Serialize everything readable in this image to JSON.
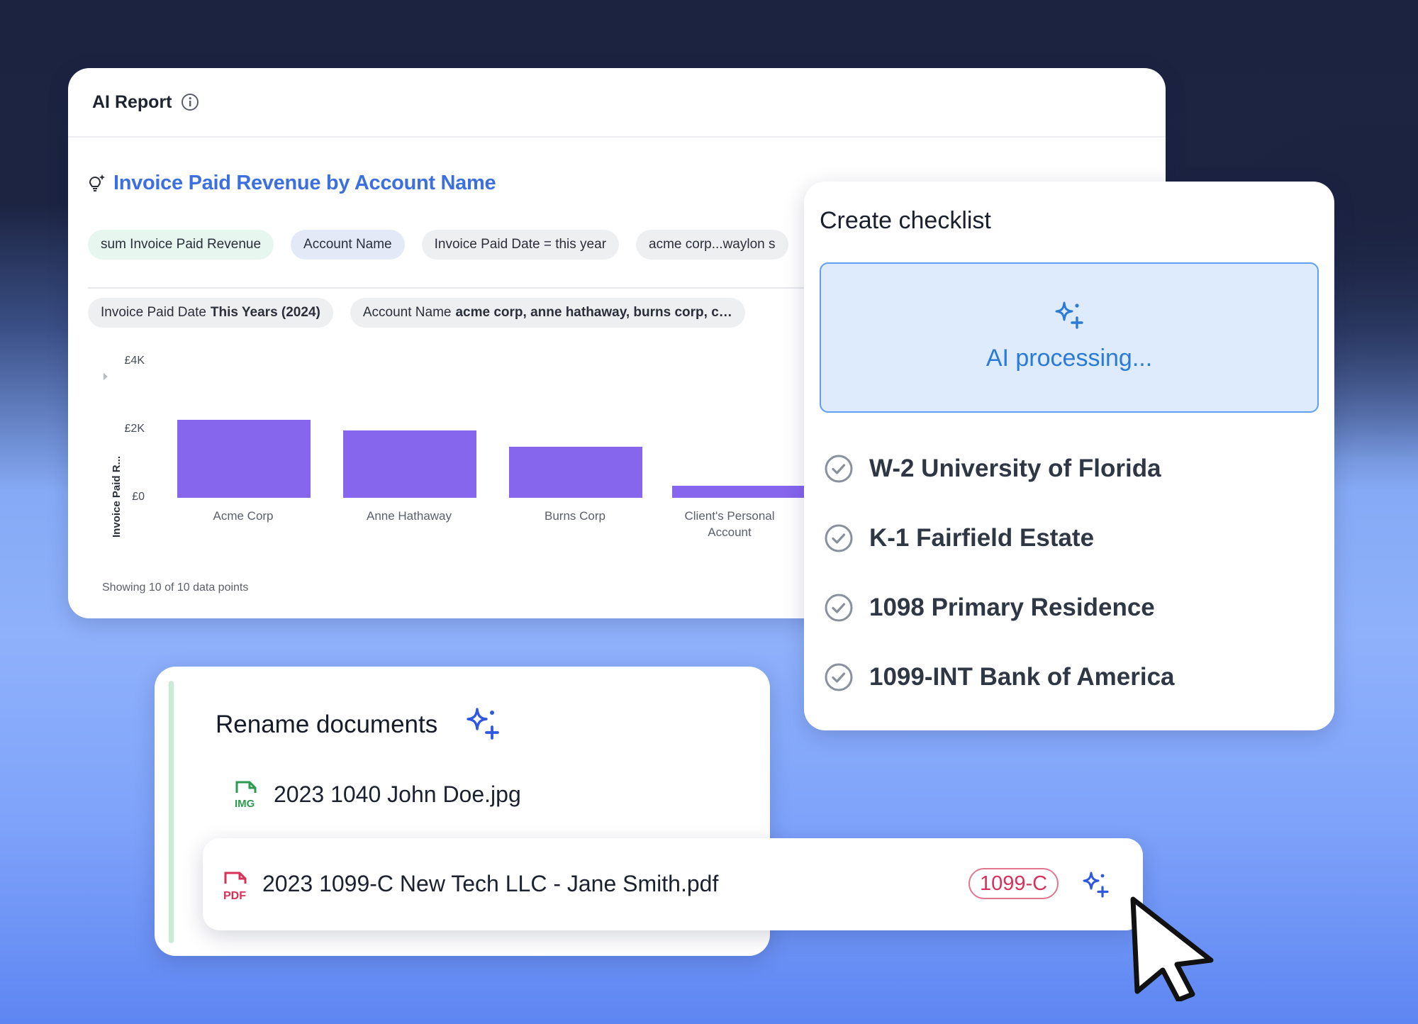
{
  "report": {
    "title": "AI Report",
    "chart_heading": "Invoice Paid Revenue by Account Name",
    "pills_row1": [
      {
        "text": "sum  Invoice Paid Revenue",
        "bg": "#e7f6ef"
      },
      {
        "text": "Account Name",
        "bg": "#e4e9f8"
      },
      {
        "text": "Invoice Paid Date = this year",
        "bg": "#eeeff1"
      },
      {
        "text": "acme corp...waylon s",
        "bg": "#eeeff1"
      }
    ],
    "pills_row2": [
      {
        "label": "Invoice Paid Date",
        "value": "This Years (2024)"
      },
      {
        "label": "Account Name",
        "value": "acme corp, anne hathaway, burns corp, c…"
      }
    ],
    "footer": "Showing 10 of 10 data points"
  },
  "chart_data": {
    "type": "bar",
    "ylabel": "Invoice Paid R...",
    "ylim": [
      0,
      4000
    ],
    "yticks": [
      "£4K",
      "£2K",
      "£0"
    ],
    "categories": [
      "Acme Corp",
      "Anne Hathaway",
      "Burns Corp",
      "Client's Personal Account"
    ],
    "values": [
      2300,
      1970,
      1490,
      350
    ],
    "color": "#8566ed"
  },
  "checklist": {
    "title": "Create checklist",
    "processing_text": "AI processing...",
    "items": [
      "W-2 University of Florida",
      "K-1 Fairfield Estate",
      "1098 Primary Residence",
      "1099-INT Bank of America"
    ]
  },
  "rename": {
    "title": "Rename documents",
    "files": [
      {
        "type_label": "IMG",
        "name": "2023 1040 John Doe.jpg",
        "icon": "image-file-icon"
      },
      {
        "type_label": "PDF",
        "name": "2023 1099-C New Tech LLC - Jane Smith.pdf",
        "icon": "pdf-file-icon",
        "badge": "1099-C"
      }
    ]
  },
  "colors": {
    "accent_blue": "#3c6fe0",
    "bar_purple": "#8566ed",
    "badge_red": "#d7315b",
    "img_green": "#2e9a4f"
  }
}
